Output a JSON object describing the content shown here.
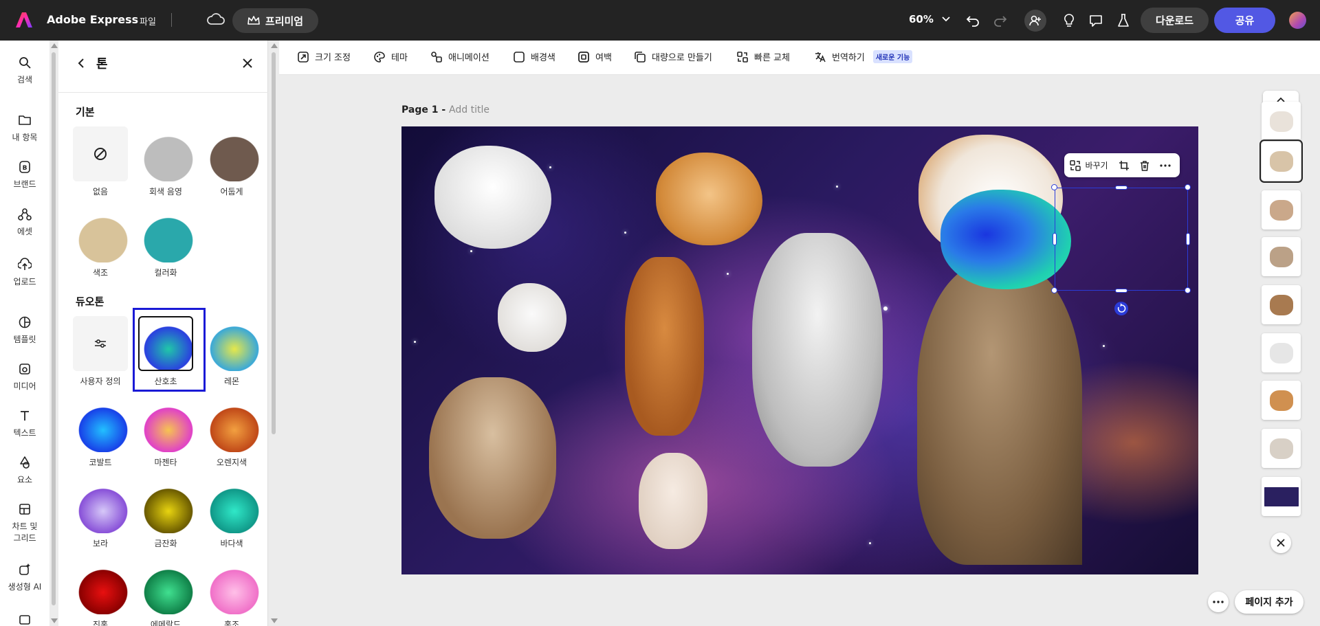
{
  "topbar": {
    "app_title": "Adobe Express",
    "file_menu": "파일",
    "premium_label": "프리미엄",
    "zoom": "60%",
    "download_label": "다운로드",
    "share_label": "공유"
  },
  "rail": {
    "items": [
      {
        "label": "검색",
        "icon": "search-icon"
      },
      {
        "label": "내 항목",
        "icon": "folder-icon"
      },
      {
        "label": "브랜드",
        "icon": "brand-icon"
      },
      {
        "label": "에셋",
        "icon": "shapes-icon"
      },
      {
        "label": "업로드",
        "icon": "upload-icon"
      },
      {
        "label": "템플릿",
        "icon": "template-icon"
      },
      {
        "label": "미디어",
        "icon": "media-icon"
      },
      {
        "label": "텍스트",
        "icon": "text-icon"
      },
      {
        "label": "요소",
        "icon": "elements-icon"
      },
      {
        "label": "차트 및",
        "label2": "그리드",
        "icon": "chart-grid-icon"
      },
      {
        "label": "생성형 AI",
        "icon": "generative-ai-icon"
      }
    ]
  },
  "panel": {
    "title": "톤",
    "basic_title": "기본",
    "duotone_title": "듀오톤",
    "basic": [
      {
        "label": "없음",
        "kind": "none"
      },
      {
        "label": "회색 음영",
        "color": "#bdbdbd"
      },
      {
        "label": "어둡게",
        "color": "#6f5a4e"
      },
      {
        "label": "색조",
        "color": "#d8c39a"
      },
      {
        "label": "컬러화",
        "color": "#2aa8ab"
      }
    ],
    "duotone": [
      {
        "label": "사용자 정의",
        "kind": "custom"
      },
      {
        "label": "산호초",
        "color": "#20c8a8",
        "color2": "#2a3fe0",
        "selected": true
      },
      {
        "label": "레몬",
        "color": "#e6e84a",
        "color2": "#3aa8d8"
      },
      {
        "label": "코발트",
        "color": "#22c0ff",
        "color2": "#1840e8"
      },
      {
        "label": "마젠타",
        "color": "#f6c450",
        "color2": "#e040c8"
      },
      {
        "label": "오렌지색",
        "color": "#f2a040",
        "color2": "#c04818"
      },
      {
        "label": "보라",
        "color": "#d6c8f8",
        "color2": "#8850d8"
      },
      {
        "label": "금잔화",
        "color": "#e8d410",
        "color2": "#6a5a00"
      },
      {
        "label": "바다색",
        "color": "#30e8c8",
        "color2": "#109888"
      },
      {
        "label": "진홍",
        "color": "#e81010",
        "color2": "#8a0000"
      },
      {
        "label": "에메랄드",
        "color": "#40e090",
        "color2": "#108048"
      },
      {
        "label": "홍조",
        "color": "#ffc0e8",
        "color2": "#f070c8"
      }
    ]
  },
  "toolbar": {
    "tools": [
      {
        "label": "크기 조정",
        "icon": "resize-icon"
      },
      {
        "label": "테마",
        "icon": "palette-icon"
      },
      {
        "label": "애니메이션",
        "icon": "animation-icon"
      },
      {
        "label": "배경색",
        "icon": "checkbox-icon"
      },
      {
        "label": "여백",
        "icon": "padding-icon"
      },
      {
        "label": "대량으로 만들기",
        "icon": "bulk-create-icon"
      },
      {
        "label": "빠른 교체",
        "icon": "quick-replace-icon"
      },
      {
        "label": "번역하기",
        "icon": "translate-icon"
      }
    ],
    "new_badge": "새로운 기능"
  },
  "canvas": {
    "page_label": "Page 1 - ",
    "page_placeholder": "Add title",
    "replace_label": "바꾸기"
  },
  "pages": {
    "add_page_label": "페이지 추가",
    "thumbnail_count": 9
  }
}
